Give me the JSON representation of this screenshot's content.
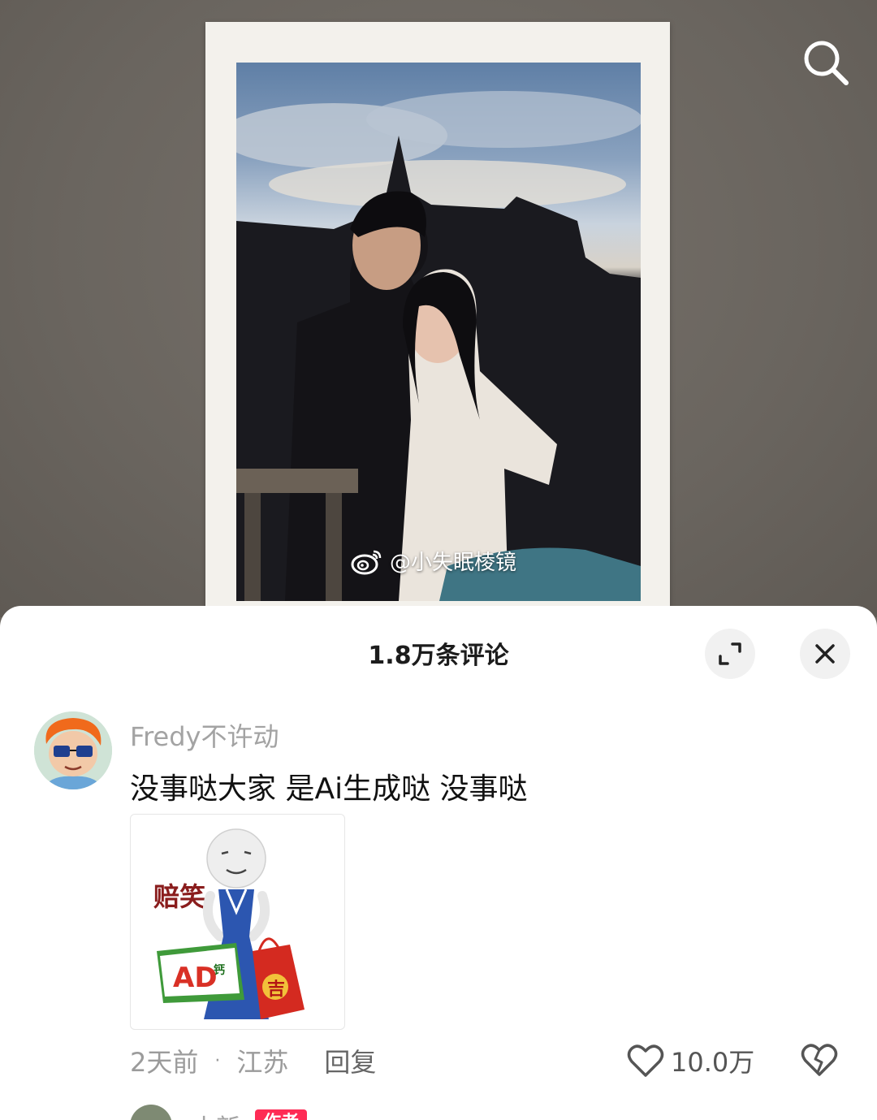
{
  "photo": {
    "watermark": "@小失眠棱镜"
  },
  "icons": {
    "search": "search-icon",
    "expand": "expand-icon",
    "close": "close-icon",
    "like": "heart-icon",
    "dislike": "broken-heart-icon",
    "weibo": "weibo-icon"
  },
  "comments_panel": {
    "title": "1.8万条评论"
  },
  "comment": {
    "username": "Fredy不许动",
    "text": "没事哒大家 是Ai生成哒 没事哒",
    "sticker_caption": "赔笑",
    "time": "2天前",
    "location": "江苏",
    "separator": "·",
    "reply_label": "回复",
    "like_count": "10.0万"
  },
  "next_comment": {
    "username": "小新",
    "badge": "作者"
  },
  "colors": {
    "accent_badge": "#fe2c55",
    "username_gray": "#a3a3a3",
    "sheet_bg": "#ffffff"
  }
}
